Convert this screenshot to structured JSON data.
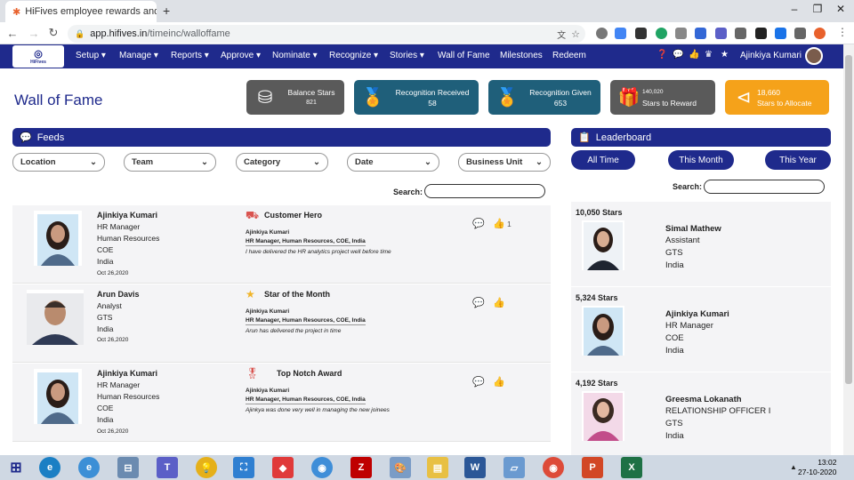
{
  "browser": {
    "tab_title": "HiFives employee rewards and re",
    "new_tab_symbol": "+",
    "url_domain": "app.hifives.in",
    "url_path": "/timeinc/walloffame"
  },
  "nav": {
    "logo_text": "HiFives",
    "menu": [
      {
        "label": "Setup",
        "dropdown": true
      },
      {
        "label": "Manage",
        "dropdown": true
      },
      {
        "label": "Reports",
        "dropdown": true
      },
      {
        "label": "Approve",
        "dropdown": true
      },
      {
        "label": "Nominate",
        "dropdown": true
      },
      {
        "label": "Recognize",
        "dropdown": true
      },
      {
        "label": "Stories",
        "dropdown": true
      },
      {
        "label": "Wall of Fame",
        "dropdown": false
      },
      {
        "label": "Milestones",
        "dropdown": false
      },
      {
        "label": "Redeem",
        "dropdown": false
      }
    ],
    "user_name": "Ajinkiya Kumari"
  },
  "page": {
    "title": "Wall of Fame"
  },
  "stats": [
    {
      "label": "Balance Stars",
      "value": "821",
      "color": "#5a5a5a",
      "icon": "coins-icon"
    },
    {
      "label": "Recognition Received",
      "value": "58",
      "color": "#1f5f7a",
      "icon": "medal-icon"
    },
    {
      "label": "Recognition Given",
      "value": "653",
      "color": "#1f5f7a",
      "icon": "medal-icon"
    },
    {
      "label": "Stars to Reward",
      "value": "140,020",
      "color": "#5a5a5a",
      "icon": "gift-icon"
    },
    {
      "label": "Stars to Allocate",
      "value": "18,660",
      "color": "#f5a21a",
      "icon": "share-icon"
    }
  ],
  "feeds": {
    "header": "Feeds",
    "filters": [
      "Location",
      "Team",
      "Category",
      "Date",
      "Business Unit"
    ],
    "search_label": "Search:",
    "items": [
      {
        "name": "Ajinkiya Kumari",
        "role": "HR Manager",
        "dept": "Human Resources",
        "unit": "COE",
        "country": "India",
        "date": "Oct 26,2020",
        "award": "Customer Hero",
        "by": "Ajinkiya Kumari",
        "by_desc": "HR Manager, Human Resources, COE, India",
        "message": "I have delivered the HR analytics project well before time",
        "likes": "1"
      },
      {
        "name": "Arun Davis",
        "role": "Analyst",
        "dept": "GTS",
        "unit": "India",
        "country": "",
        "date": "Oct 26,2020",
        "award": "Star of the Month",
        "by": "Ajinkiya Kumari",
        "by_desc": "HR Manager, Human Resources, COE, India",
        "message": "Arun has delivered the project in time",
        "likes": ""
      },
      {
        "name": "Ajinkiya Kumari",
        "role": "HR Manager",
        "dept": "Human Resources",
        "unit": "COE",
        "country": "India",
        "date": "Oct 26,2020",
        "award": "Top Notch Award",
        "by": "Ajinkiya Kumari",
        "by_desc": "HR Manager, Human Resources, COE, India",
        "message": "Ajinkya was done very well in managing the new joinees",
        "likes": ""
      }
    ]
  },
  "leaderboard": {
    "header": "Leaderboard",
    "tabs": [
      "All Time",
      "This Month",
      "This Year"
    ],
    "search_label": "Search:",
    "items": [
      {
        "stars": "10,050 Stars",
        "name": "Simal Mathew",
        "role": "Assistant",
        "dept": "GTS",
        "country": "India"
      },
      {
        "stars": "5,324 Stars",
        "name": "Ajinkiya Kumari",
        "role": "HR Manager",
        "dept": "COE",
        "country": "India"
      },
      {
        "stars": "4,192 Stars",
        "name": "Greesma Lokanath",
        "role": "RELATIONSHIP OFFICER I",
        "dept": "GTS",
        "country": "India"
      }
    ]
  },
  "taskbar": {
    "time": "13:02",
    "date": "27-10-2020"
  }
}
